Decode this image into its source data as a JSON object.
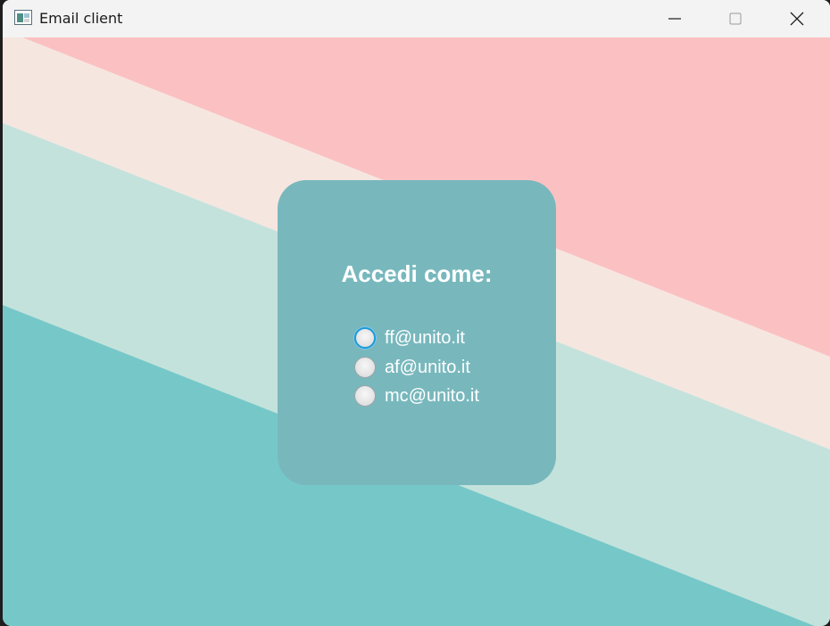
{
  "window": {
    "title": "Email client",
    "icon": "app-window-icon",
    "controls": {
      "minimize_icon": "minimize-icon",
      "maximize_icon": "maximize-icon",
      "close_icon": "close-icon"
    }
  },
  "background": {
    "stripe_colors": [
      "#fbc1c2",
      "#f6e6e0",
      "#c4e2dc",
      "#76c8c8"
    ]
  },
  "login": {
    "title": "Accedi come:",
    "card_color": "#78b8bd",
    "accounts": [
      {
        "label": "ff@unito.it",
        "focused": true
      },
      {
        "label": "af@unito.it",
        "focused": false
      },
      {
        "label": "mc@unito.it",
        "focused": false
      }
    ]
  }
}
